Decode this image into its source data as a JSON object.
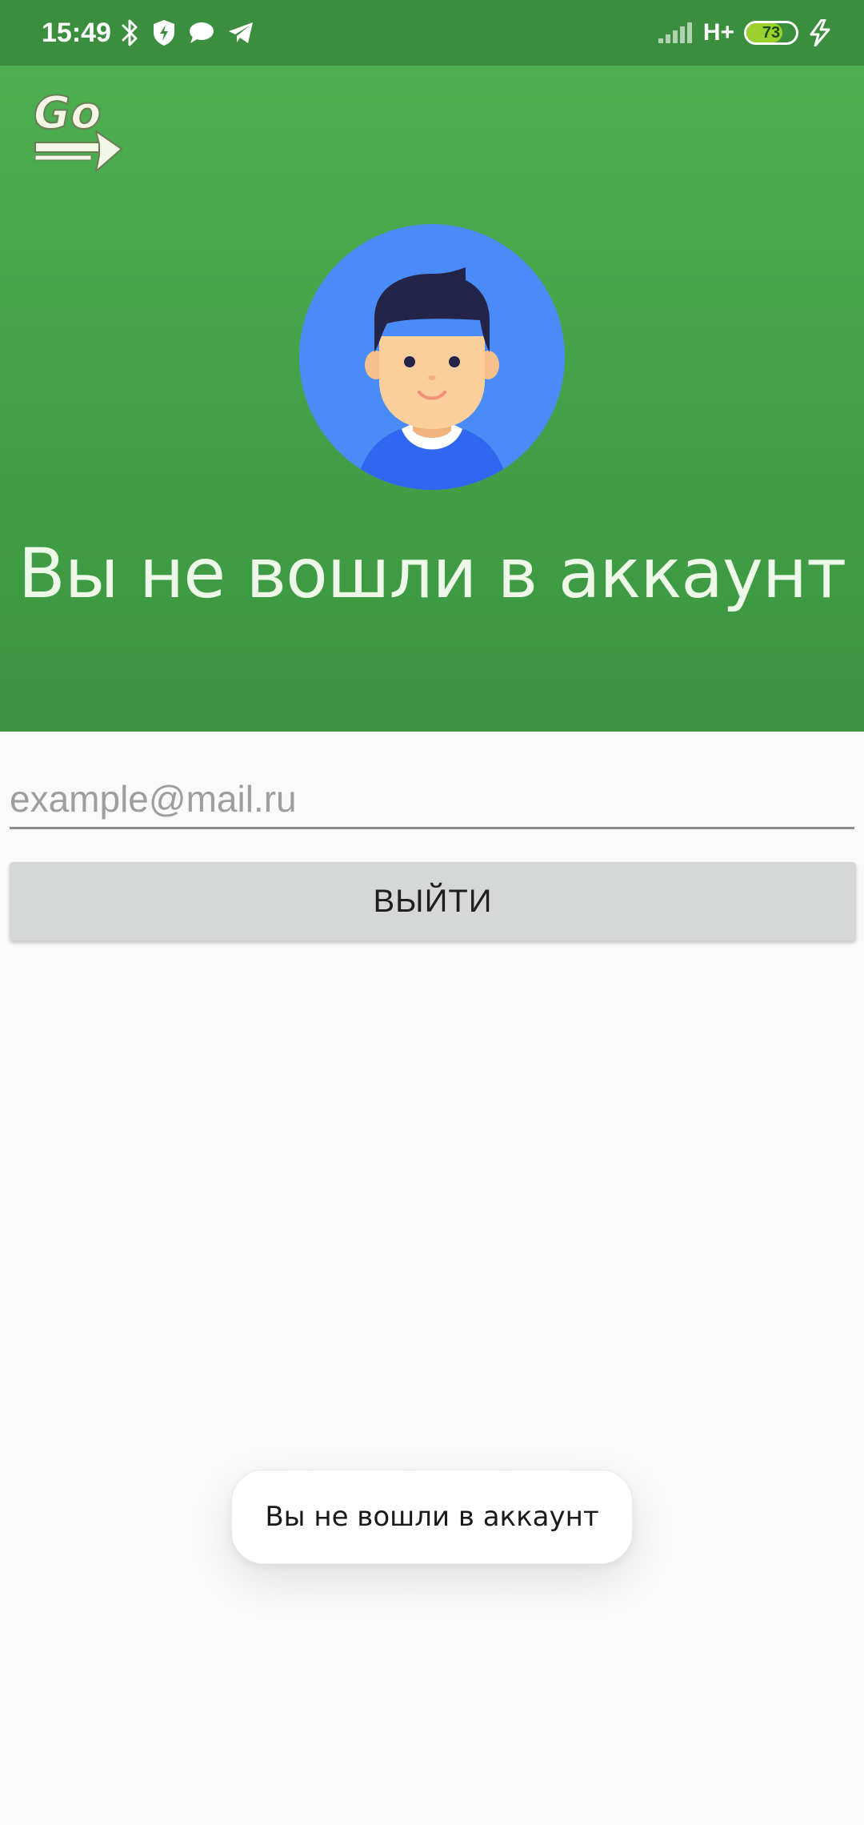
{
  "status_bar": {
    "time": "15:49",
    "left_icons": [
      "bluetooth-icon",
      "shield-bolt-icon",
      "chat-bubble-icon",
      "telegram-icon"
    ],
    "signal": "signal-bars-icon",
    "network_type": "H+",
    "battery_level": "73",
    "battery_percent": 73,
    "charging": "charging-bolt-icon",
    "background": "#3b8e3e"
  },
  "header": {
    "logo": "go-arrow-logo",
    "avatar": "user-avatar-illustration",
    "title": "Вы не вошли в аккаунт",
    "gradient_top": "#4caf50",
    "gradient_bottom": "#3b9440"
  },
  "form": {
    "email_placeholder": "example@mail.ru",
    "email_value": "",
    "logout_label": "ВЫЙТИ"
  },
  "toast": {
    "message": "Вы не вошли в аккаунт"
  }
}
